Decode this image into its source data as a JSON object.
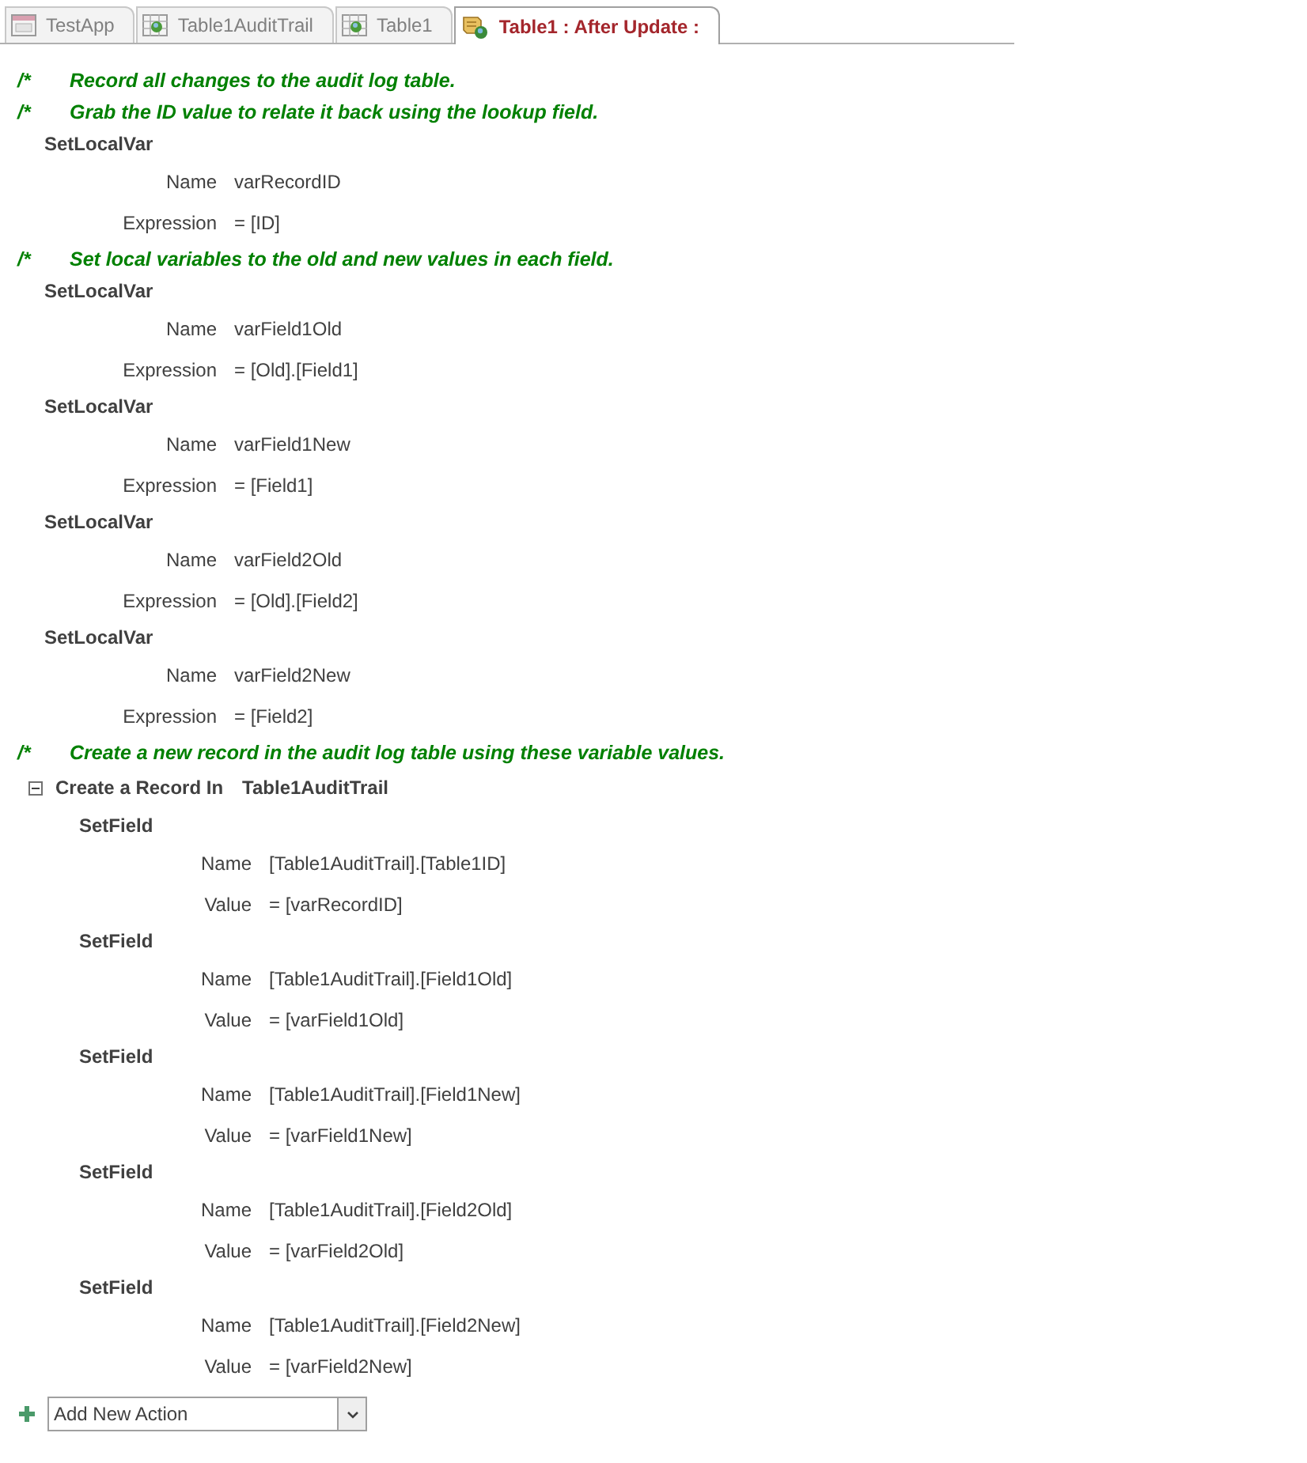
{
  "tabs": [
    {
      "label": "TestApp",
      "kind": "form",
      "selected": false
    },
    {
      "label": "Table1AuditTrail",
      "kind": "table",
      "selected": false
    },
    {
      "label": "Table1",
      "kind": "table",
      "selected": false
    },
    {
      "label": "Table1 : After Update :",
      "kind": "macro",
      "selected": true
    }
  ],
  "comment_mark": "/*",
  "items": [
    {
      "kind": "comment",
      "text": "Record all changes to the audit log table."
    },
    {
      "kind": "comment",
      "text": "Grab the ID value to relate it back using the lookup field."
    },
    {
      "kind": "action",
      "name": "SetLocalVar",
      "args": [
        {
          "label": "Name",
          "value": "varRecordID"
        },
        {
          "label": "Expression",
          "value": "= [ID]"
        }
      ]
    },
    {
      "kind": "comment",
      "text": "Set local variables to the old and new values in each field."
    },
    {
      "kind": "action",
      "name": "SetLocalVar",
      "args": [
        {
          "label": "Name",
          "value": "varField1Old"
        },
        {
          "label": "Expression",
          "value": "= [Old].[Field1]"
        }
      ]
    },
    {
      "kind": "action",
      "name": "SetLocalVar",
      "args": [
        {
          "label": "Name",
          "value": "varField1New"
        },
        {
          "label": "Expression",
          "value": "= [Field1]"
        }
      ]
    },
    {
      "kind": "action",
      "name": "SetLocalVar",
      "args": [
        {
          "label": "Name",
          "value": "varField2Old"
        },
        {
          "label": "Expression",
          "value": "= [Old].[Field2]"
        }
      ]
    },
    {
      "kind": "action",
      "name": "SetLocalVar",
      "args": [
        {
          "label": "Name",
          "value": "varField2New"
        },
        {
          "label": "Expression",
          "value": "= [Field2]"
        }
      ]
    },
    {
      "kind": "comment",
      "text": "Create a new record in the audit log table using these variable values."
    },
    {
      "kind": "block",
      "title": "Create a Record In",
      "target": "Table1AuditTrail",
      "expanded": true,
      "children": [
        {
          "kind": "action",
          "name": "SetField",
          "args": [
            {
              "label": "Name",
              "value": "[Table1AuditTrail].[Table1ID]"
            },
            {
              "label": "Value",
              "value": "= [varRecordID]"
            }
          ]
        },
        {
          "kind": "action",
          "name": "SetField",
          "args": [
            {
              "label": "Name",
              "value": "[Table1AuditTrail].[Field1Old]"
            },
            {
              "label": "Value",
              "value": "= [varField1Old]"
            }
          ]
        },
        {
          "kind": "action",
          "name": "SetField",
          "args": [
            {
              "label": "Name",
              "value": "[Table1AuditTrail].[Field1New]"
            },
            {
              "label": "Value",
              "value": "= [varField1New]"
            }
          ]
        },
        {
          "kind": "action",
          "name": "SetField",
          "args": [
            {
              "label": "Name",
              "value": "[Table1AuditTrail].[Field2Old]"
            },
            {
              "label": "Value",
              "value": "= [varField2Old]"
            }
          ]
        },
        {
          "kind": "action",
          "name": "SetField",
          "args": [
            {
              "label": "Name",
              "value": "[Table1AuditTrail].[Field2New]"
            },
            {
              "label": "Value",
              "value": "= [varField2New]"
            }
          ]
        }
      ]
    }
  ],
  "add_action": {
    "value": "Add New Action"
  }
}
